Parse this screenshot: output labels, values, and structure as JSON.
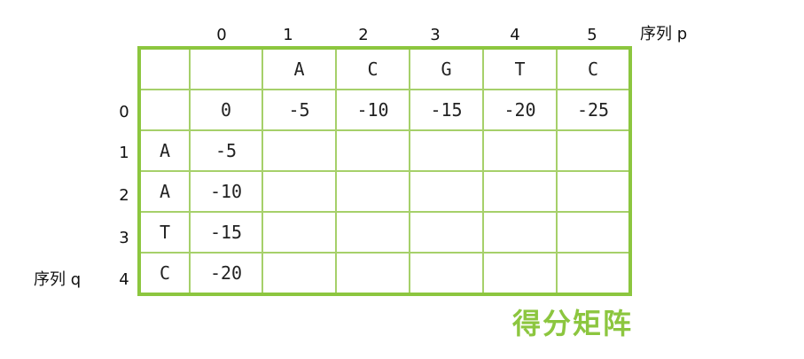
{
  "column_indices": [
    "0",
    "1",
    "2",
    "3",
    "4",
    "5"
  ],
  "row_indices": [
    "0",
    "1",
    "2",
    "3",
    "4"
  ],
  "seq_p_label": "序列 p",
  "seq_q_label": "序列 q",
  "sequence_p": [
    "A",
    "C",
    "G",
    "T",
    "C"
  ],
  "sequence_q": [
    "A",
    "A",
    "T",
    "C"
  ],
  "first_row": [
    "0",
    "-5",
    "-10",
    "-15",
    "-20",
    "-25"
  ],
  "first_column": [
    "-5",
    "-10",
    "-15",
    "-20"
  ],
  "caption": "得分矩阵",
  "colors": {
    "grid_border": "#8cc63f",
    "grid_lines": "#a6d06a",
    "caption": "#8cc63f"
  }
}
